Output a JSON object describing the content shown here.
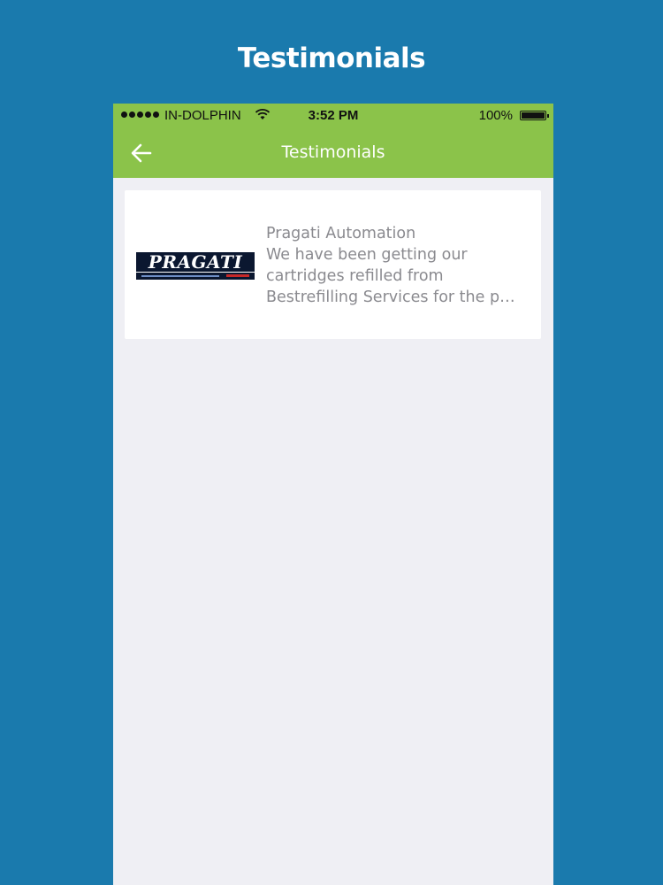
{
  "promo": {
    "title": "Testimonials"
  },
  "status_bar": {
    "carrier": "IN-DOLPHIN",
    "time": "3:52 PM",
    "battery": "100%"
  },
  "nav": {
    "title": "Testimonials",
    "back_icon": "arrow-left-icon"
  },
  "testimonials": [
    {
      "logo_text": "PRAGATI",
      "name": "Pragati Automation",
      "excerpt_lines": [
        "We have been getting our",
        "cartridges refilled from",
        "Bestrefilling Services for the p…"
      ]
    }
  ],
  "colors": {
    "background": "#1a7aad",
    "nav_green": "#8bc34a",
    "content_bg": "#efeff4",
    "text_gray": "#8a8a8f"
  }
}
